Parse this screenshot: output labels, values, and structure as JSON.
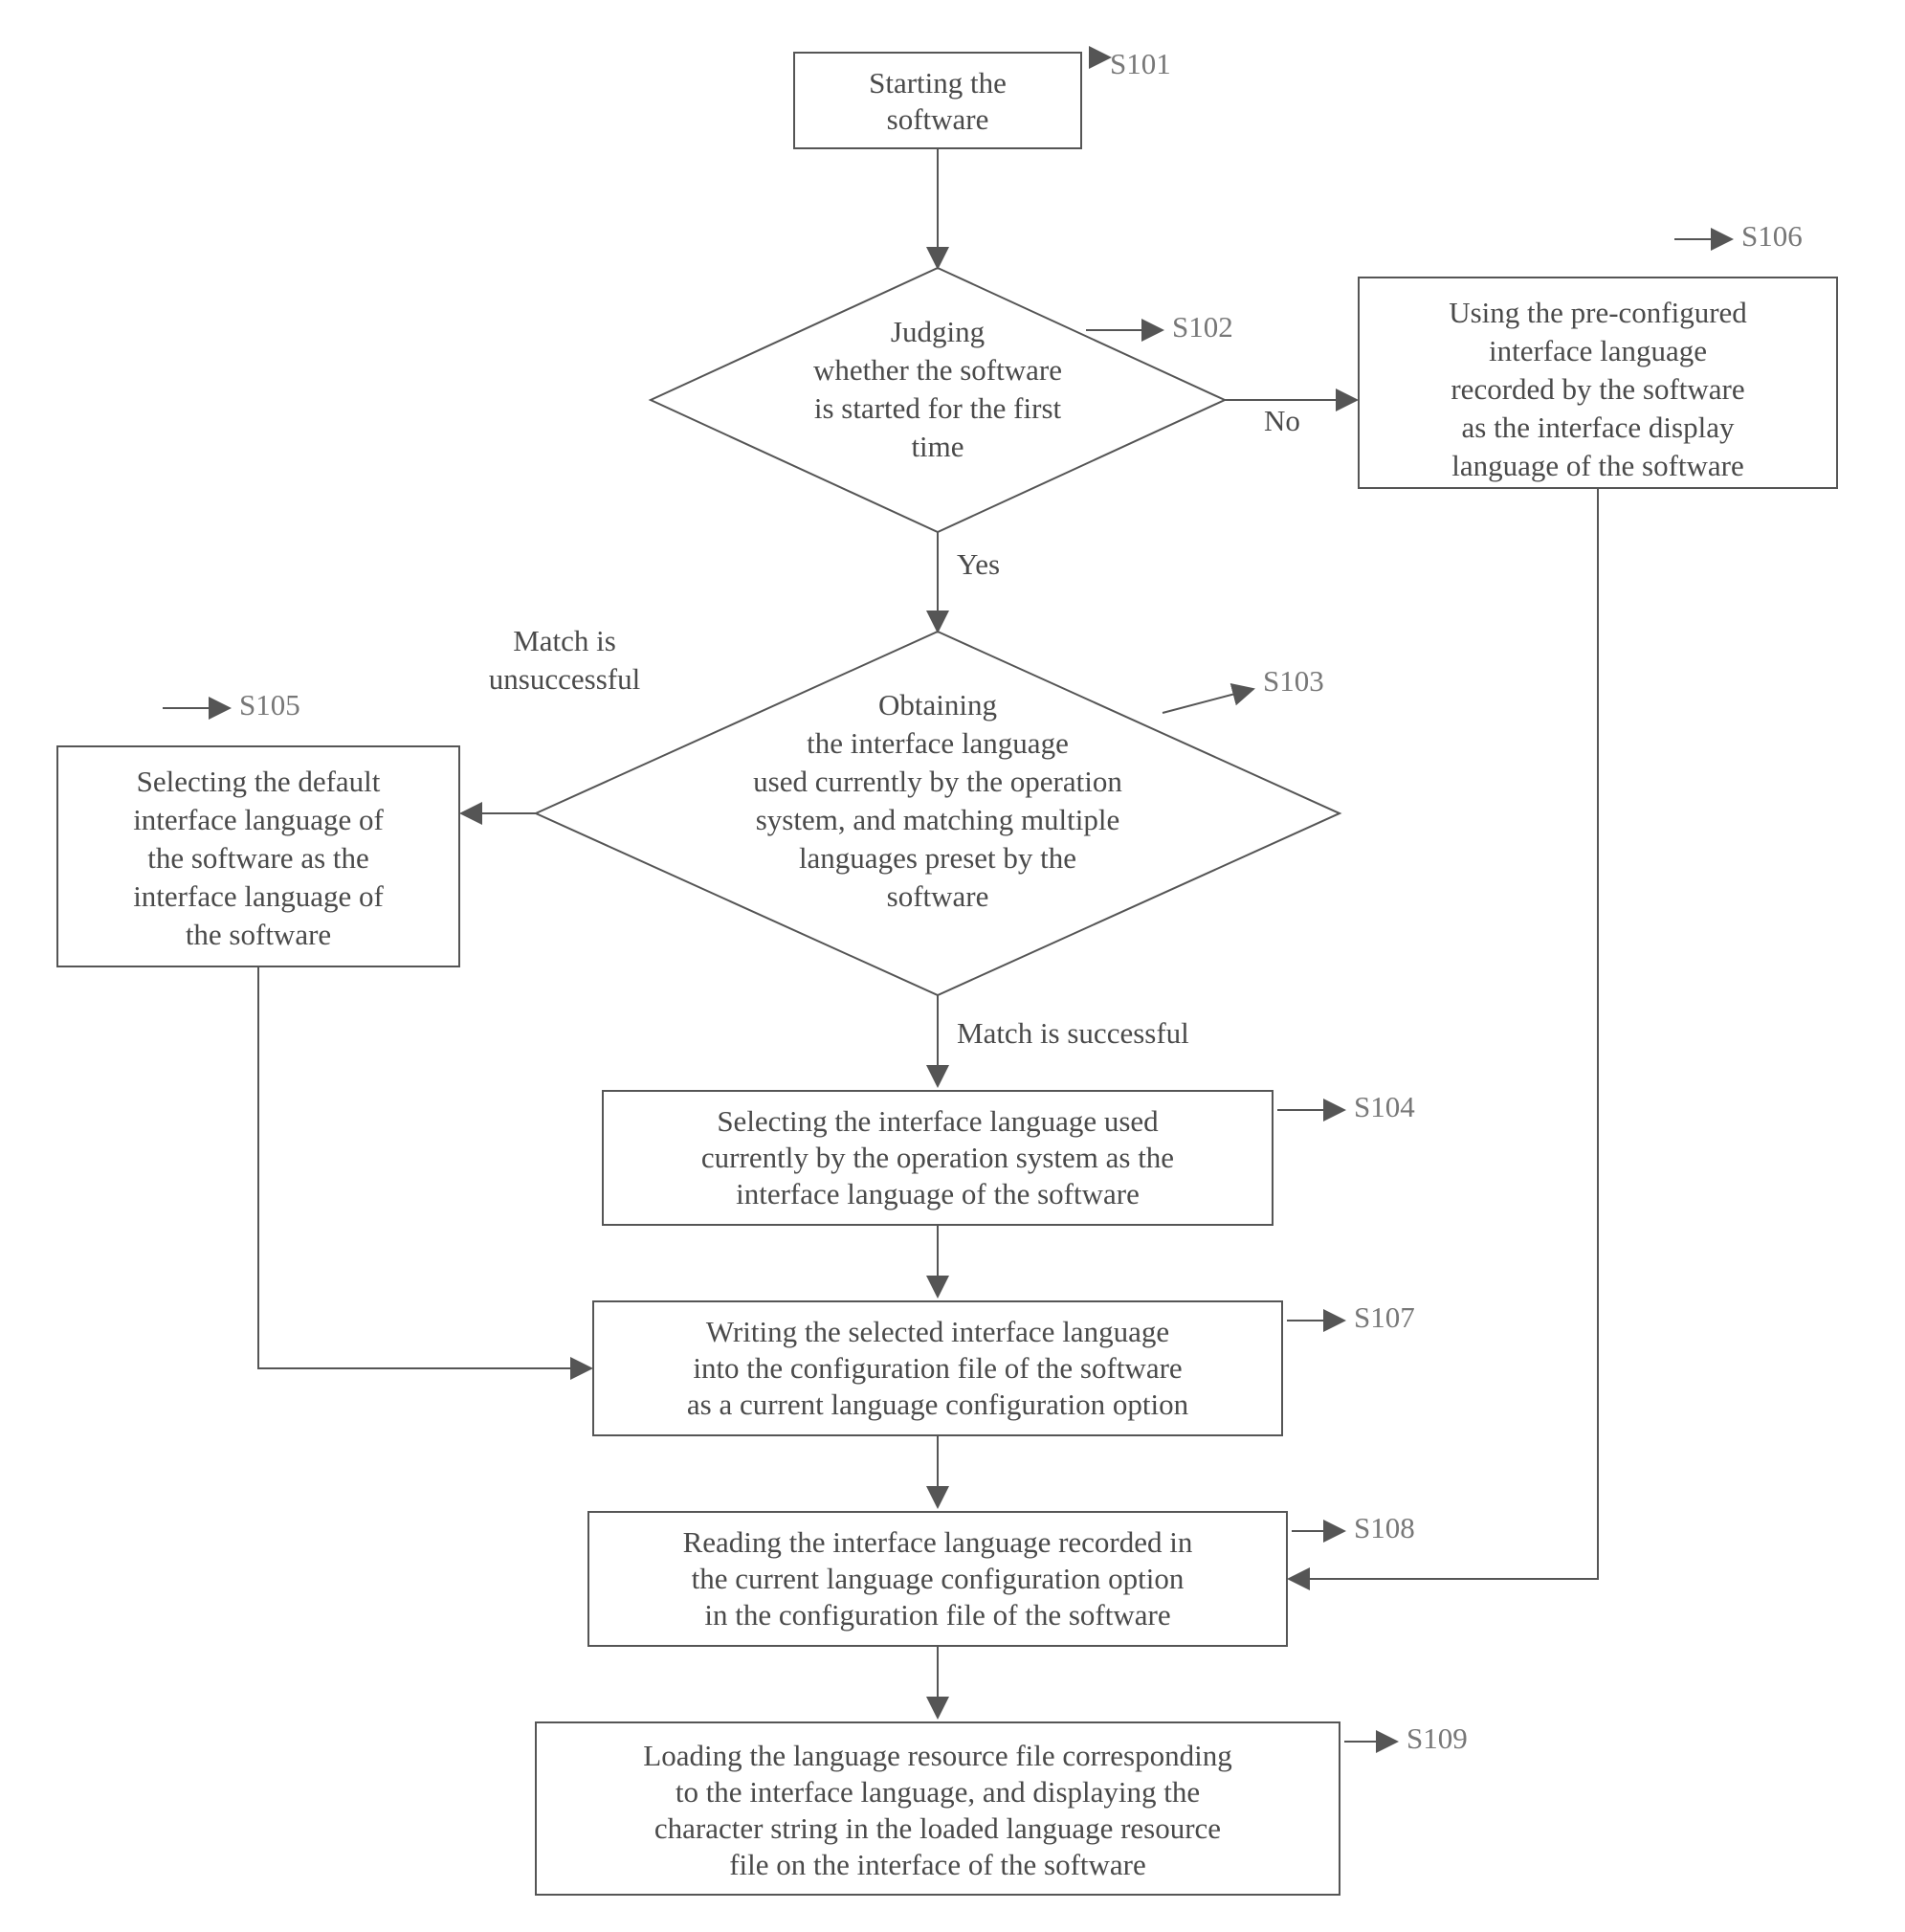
{
  "steps": {
    "s101": {
      "id": "S101",
      "text1": "Starting the",
      "text2": "software"
    },
    "s102": {
      "id": "S102",
      "text1": "Judging",
      "text2": "whether the software",
      "text3": "is started for the first",
      "text4": "time"
    },
    "s103": {
      "id": "S103",
      "text1": "Obtaining",
      "text2": "the interface language",
      "text3": "used currently by the operation",
      "text4": "system, and matching multiple",
      "text5": "languages preset by the",
      "text6": "software"
    },
    "s104": {
      "id": "S104",
      "text1": "Selecting the interface language used",
      "text2": "currently by the operation system as the",
      "text3": "interface language of the software"
    },
    "s105": {
      "id": "S105",
      "text1": "Selecting the default",
      "text2": "interface language of",
      "text3": "the software as the",
      "text4": "interface language of",
      "text5": "the software"
    },
    "s106": {
      "id": "S106",
      "text1": "Using the pre-configured",
      "text2": "interface language",
      "text3": "recorded by the software",
      "text4": "as the interface display",
      "text5": "language of the software"
    },
    "s107": {
      "id": "S107",
      "text1": "Writing the selected interface language",
      "text2": "into the configuration file of the software",
      "text3": "as a current language configuration option"
    },
    "s108": {
      "id": "S108",
      "text1": "Reading the interface language recorded in",
      "text2": "the current language configuration option",
      "text3": "in the configuration file of the software"
    },
    "s109": {
      "id": "S109",
      "text1": "Loading the language resource file corresponding",
      "text2": "to the interface language, and displaying the",
      "text3": "character string in the loaded language resource",
      "text4": "file on the interface of the software"
    }
  },
  "edges": {
    "yes": "Yes",
    "no": "No",
    "match_ok": "Match is successful",
    "match_fail1": "Match is",
    "match_fail2": "unsuccessful"
  }
}
